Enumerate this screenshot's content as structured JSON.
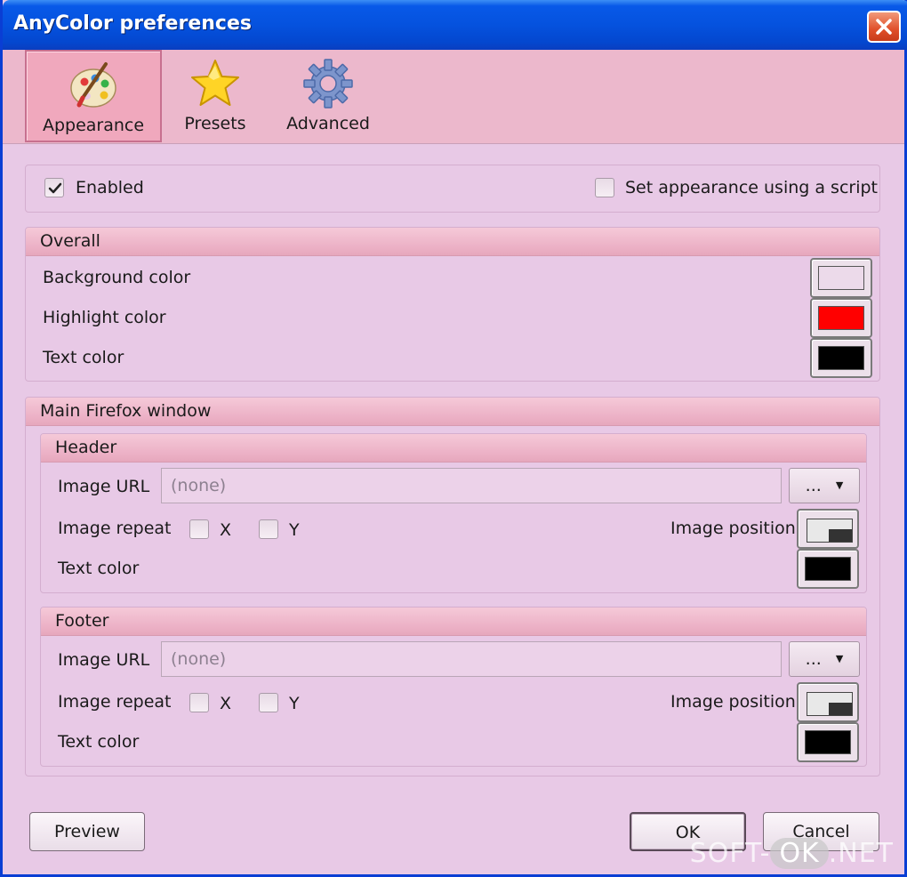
{
  "window": {
    "title": "AnyColor preferences"
  },
  "toolbar": {
    "tabs": [
      {
        "label": "Appearance",
        "icon": "palette-icon",
        "active": true
      },
      {
        "label": "Presets",
        "icon": "star-icon",
        "active": false
      },
      {
        "label": "Advanced",
        "icon": "gear-icon",
        "active": false
      }
    ]
  },
  "general": {
    "enabled_label": "Enabled",
    "enabled_checked": true,
    "script_label": "Set appearance using a script",
    "script_checked": false
  },
  "overall": {
    "title": "Overall",
    "rows": [
      {
        "label": "Background color",
        "color": "#ecdaea"
      },
      {
        "label": "Highlight color",
        "color": "#ff0000"
      },
      {
        "label": "Text color",
        "color": "#000000"
      }
    ]
  },
  "main_window": {
    "title": "Main Firefox window",
    "header": {
      "title": "Header",
      "image_url_label": "Image URL",
      "image_url_placeholder": "(none)",
      "browse_label": "...",
      "image_repeat_label": "Image repeat",
      "repeat_x_label": "X",
      "repeat_y_label": "Y",
      "image_position_label": "Image position",
      "text_color_label": "Text color",
      "text_color": "#000000"
    },
    "footer": {
      "title": "Footer",
      "image_url_label": "Image URL",
      "image_url_placeholder": "(none)",
      "browse_label": "...",
      "image_repeat_label": "Image repeat",
      "repeat_x_label": "X",
      "repeat_y_label": "Y",
      "image_position_label": "Image position",
      "text_color_label": "Text color",
      "text_color": "#000000"
    }
  },
  "buttons": {
    "preview": "Preview",
    "ok": "OK",
    "cancel": "Cancel"
  },
  "watermark": {
    "left": "SOFT-",
    "pill": "OK",
    "right": ".NET"
  }
}
